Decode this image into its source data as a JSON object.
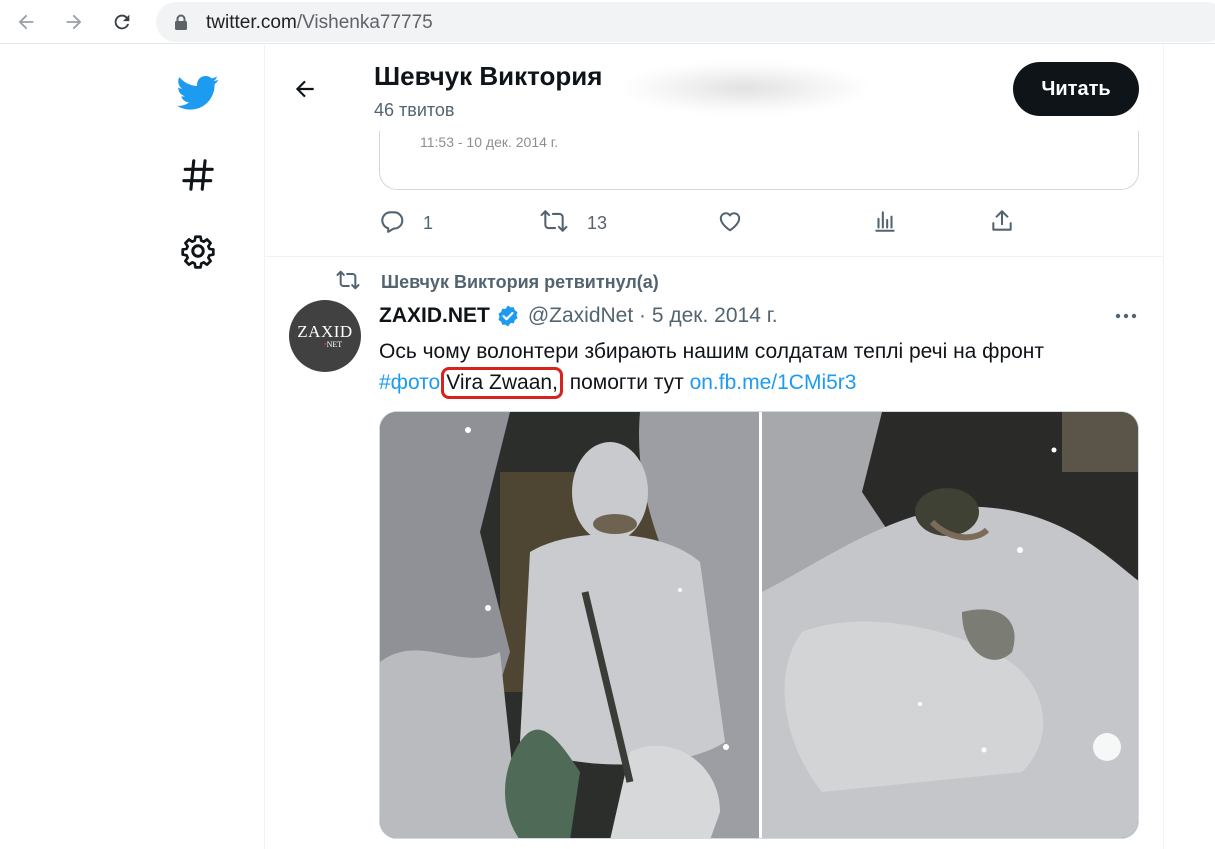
{
  "browser": {
    "url_host": "twitter.com",
    "url_path": "/Vishenka77775",
    "icons": [
      "back-arrow-icon",
      "forward-arrow-icon",
      "reload-icon",
      "lock-icon"
    ]
  },
  "nav": {
    "icons": [
      "twitter-bird-icon",
      "hashtag-icon",
      "gear-icon"
    ],
    "brand_color": "#1d9bf0"
  },
  "header": {
    "name": "Шевчук Виктория",
    "tweet_count": "46 твитов",
    "follow_label": "Читать"
  },
  "quoted": {
    "time": "11:53 - 10 дек. 2014 г."
  },
  "actions": {
    "replies": "1",
    "retweets": "13"
  },
  "retweet": {
    "label": "Шевчук Виктория ретвитнул(а)"
  },
  "tweet": {
    "avatar_text_1": "ZAXID",
    "avatar_text_2": "NET",
    "author": "ZAXID.NET",
    "handle": "@ZaxidNet · 5 дек. 2014 г.",
    "text_line1": "Ось чому волонтери збирають нашим солдатам теплі речі на фронт",
    "hashtag": "#фото",
    "mention": "Vira Zwaan,",
    "text_rest": " помогти тут ",
    "link": "on.fb.me/1CMi5r3"
  },
  "colors": {
    "link": "#1d9bf0",
    "highlight_box": "#d9211d",
    "secondary_text": "#536471"
  }
}
